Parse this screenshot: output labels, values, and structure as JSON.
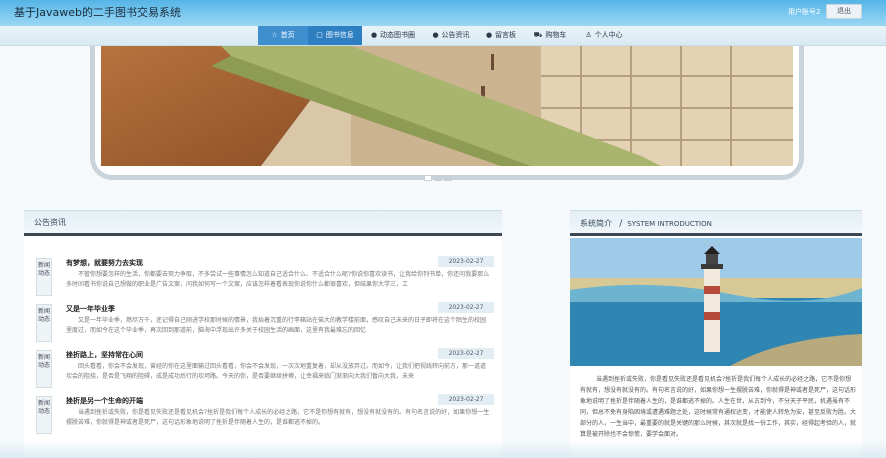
{
  "header": {
    "site_title": "基于Javaweb的二手图书交易系统",
    "user_account": "用户账号2",
    "logout_label": "退出"
  },
  "nav": {
    "items": [
      {
        "label": "首页",
        "icon": "home-icon"
      },
      {
        "label": "图书信息",
        "icon": "book-icon"
      },
      {
        "label": "动态图书圈",
        "icon": "info-icon"
      },
      {
        "label": "公告资讯",
        "icon": "info-icon"
      },
      {
        "label": "留言板",
        "icon": "info-icon"
      },
      {
        "label": "购物车",
        "icon": "cart-icon"
      },
      {
        "label": "个人中心",
        "icon": "user-icon"
      }
    ]
  },
  "news": {
    "title": "公告资讯",
    "tag_text": "新闻动态",
    "items": [
      {
        "title": "有梦想，就要努力去实现",
        "date": "2023-02-27",
        "body": "不管你想要怎样的生活，你都要去努力争取，不多尝试一些事情怎么知道自己适合什么、不适合什么呢?你说你喜欢读书，让我给你列书单，你还问我要那么多时间看书你说自己想做的职业是广告文案，问我如何写一个文案，应该怎样着看表现你说你什么都很喜欢，但结果你大学三，工"
      },
      {
        "title": "又是一年毕业季",
        "date": "2023-02-27",
        "body": "又是一年毕业季，燃尽万千，还记得自己刚进学校那时候的情景，我抬着沉重的行李箱站在偌大的教学楼前面，感叹自己未来的日子即将在这个陌生的校园里度过，而如今在这个毕业季，再次回到那道前，脑海中浮现出许多关于校园生活的画面，这里有我最难忘的回忆"
      },
      {
        "title": "挫折路上，坚持常在心间",
        "date": "2023-02-27",
        "body": "回头看看，你会不会发现，曾经的你在这里面输过回头看看，你会不会发现，一次次地重复着，却从没放弃过。而如今，让我们把视线转向前方，那一道道坎会的阻挠，是否是飞翔的阻碍，成是成功后行的坎坷路。今天的你，是否要继续拼搏，让幸福来临门渐渐向大我们暂向大我，未来"
      },
      {
        "title": "挫折是另一个生命的开端",
        "date": "2023-02-27",
        "body": "当遇到挫折或失败，你是看见失败还是看见机会?挫折是我们每个人成长的必经之路，它不是你想有就有，想没有就没有的。有句名言说的好，如果你想一生摆脱苦难，你就得是神或者是死尸，这句话形象地说明了挫折是伴随着人生的，是谁都逃不掉的。"
      }
    ]
  },
  "intro": {
    "title": "系统简介",
    "divider": "/",
    "subtitle": "SYSTEM INTRODUCTION",
    "text": "当遇到挫折或失败，你是看见失败还是看见机会?挫折是我们每个人成长的必经之路，它不是你想有就有，想没有就没有的。有句名言说的好，如果你想一生摆脱苦难，你就得是神或者是死尸，这句话形象地说明了挫折是伴随着人生的，是谁都逃不掉的。人生在世，从古到今，不分天子平民，机遇虽有不同，但总不免有身陷困境或遭遇难题之处，这时候常有通权达变，才能使人转危为安，甚至反败为胜。大部分的人，一生当中，最重要的就是关键的那么时候，其次就是找一份工作，其实，经得起考验的人，就算是被开除也不会惊慌，要学会面对。"
  },
  "colors": {
    "header_blue": "#55b4e6",
    "nav_active": "#3f8fcf",
    "panel_dark_line": "#3c4853"
  }
}
